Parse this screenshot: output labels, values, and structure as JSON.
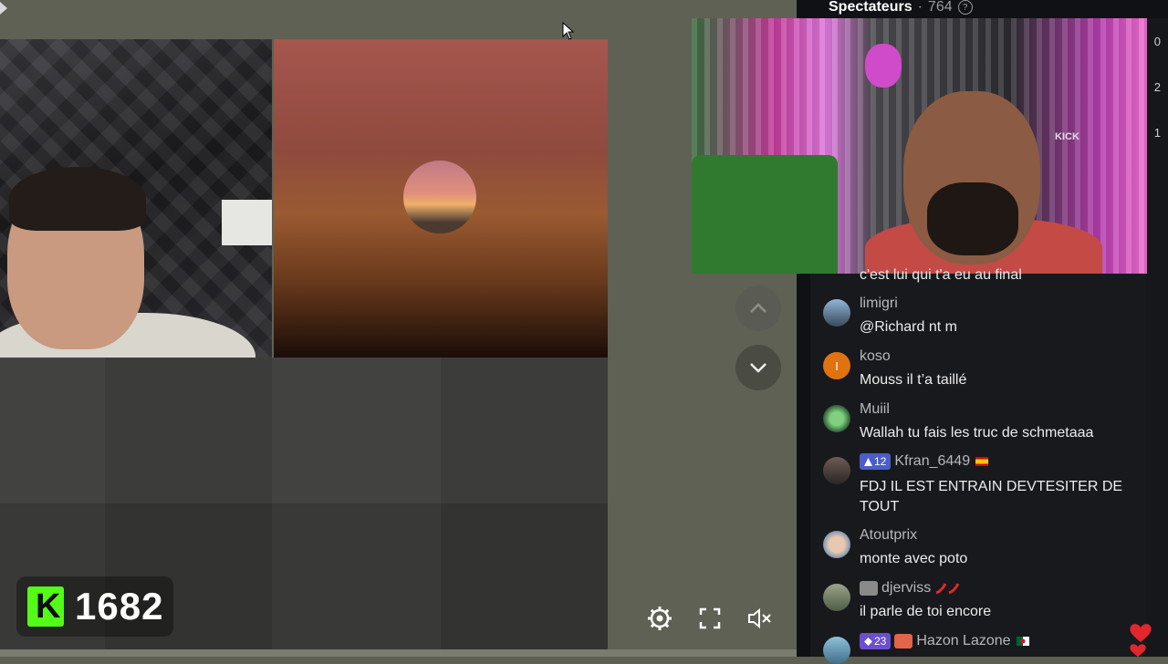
{
  "stream": {
    "score": "1682",
    "kick_logo_letter": "K"
  },
  "colors": {
    "kick_green": "#53fc18",
    "chat_bg": "#18191d",
    "level_badge": "#4b5ec8"
  },
  "chat": {
    "header_title": "Spectateurs",
    "header_separator": "·",
    "viewer_count": "764",
    "help_symbol": "?",
    "side_numbers": [
      "0",
      "2",
      "1"
    ],
    "pip_tag": "KICK",
    "partial_message": "c'est lui qui t'a eu au final",
    "messages": [
      {
        "avatar_letter": "",
        "username": "limigri",
        "text": "@Richard nt m"
      },
      {
        "avatar_letter": "I",
        "username": "koso",
        "text": "Mouss il t’a taillé"
      },
      {
        "avatar_letter": "",
        "username": "Muiil",
        "text": "Wallah tu fais les truc de schmetaaa"
      },
      {
        "avatar_letter": "",
        "badge": "12",
        "username": "Kfran_6449",
        "text": "FDJ IL EST ENTRAIN DEVTESITER DE TOUT"
      },
      {
        "avatar_letter": "",
        "username": "Atoutprix",
        "text": "monte avec poto"
      },
      {
        "avatar_letter": "",
        "username": "djerviss",
        "text": "il parle de toi encore"
      },
      {
        "avatar_letter": "",
        "badge": "23",
        "username": "Hazon Lazone",
        "text": ""
      }
    ]
  }
}
